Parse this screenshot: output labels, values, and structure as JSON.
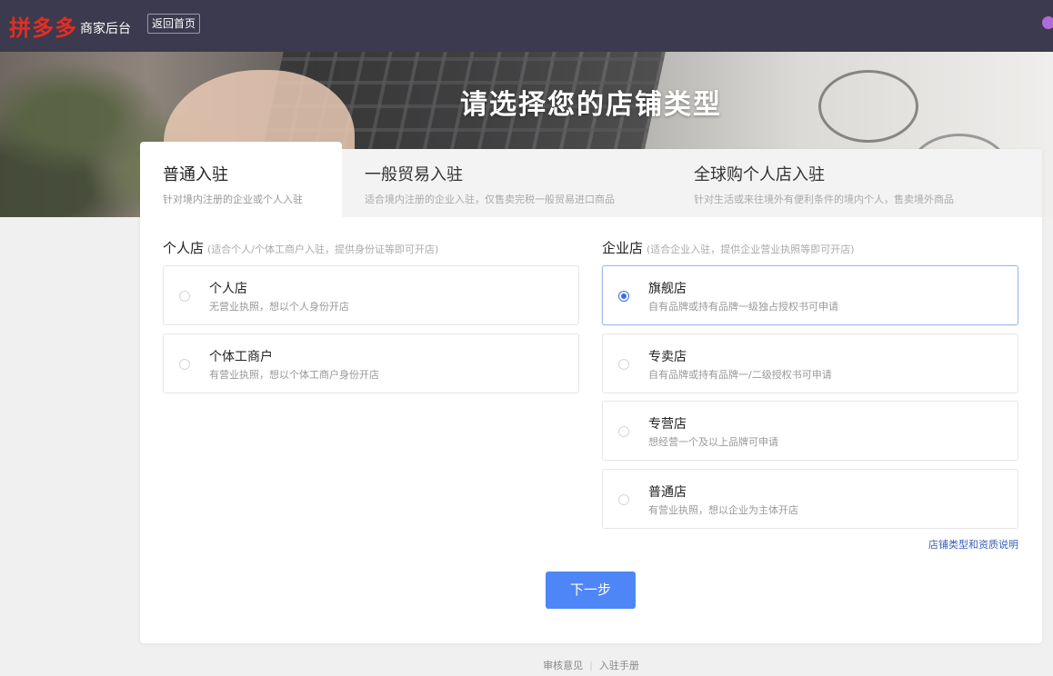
{
  "header": {
    "logo": "拼多多",
    "subtitle": "商家后台",
    "back_button": "返回首页"
  },
  "banner": {
    "title": "请选择您的店铺类型"
  },
  "tabs": [
    {
      "title": "普通入驻",
      "subtitle": "针对境内注册的企业或个人入驻",
      "active": true
    },
    {
      "title": "一般贸易入驻",
      "subtitle": "适合境内注册的企业入驻，仅售卖完税一般贸易进口商品",
      "active": false
    },
    {
      "title": "全球购个人店入驻",
      "subtitle": "针对生活或来往境外有便利条件的境内个人，售卖境外商品",
      "active": false
    }
  ],
  "personal": {
    "heading": "个人店",
    "hint": "(适合个人/个体工商户入驻，提供身份证等即可开店)",
    "options": [
      {
        "title": "个人店",
        "desc": "无营业执照，想以个人身份开店",
        "selected": false
      },
      {
        "title": "个体工商户",
        "desc": "有营业执照，想以个体工商户身份开店",
        "selected": false
      }
    ]
  },
  "enterprise": {
    "heading": "企业店",
    "hint": "(适合企业入驻，提供企业营业执照等即可开店)",
    "options": [
      {
        "title": "旗舰店",
        "desc": "自有品牌或持有品牌一级独占授权书可申请",
        "selected": true
      },
      {
        "title": "专卖店",
        "desc": "自有品牌或持有品牌一/二级授权书可申请",
        "selected": false
      },
      {
        "title": "专营店",
        "desc": "想经营一个及以上品牌可申请",
        "selected": false
      },
      {
        "title": "普通店",
        "desc": "有营业执照，想以企业为主体开店",
        "selected": false
      }
    ]
  },
  "info_link": "店铺类型和资质说明",
  "next_button": "下一步",
  "footer": {
    "links": [
      "审核意见",
      "入驻手册"
    ]
  },
  "colors": {
    "topbar": "#3b3a4e",
    "brand_red": "#e02e24",
    "primary_blue": "#4f86f7",
    "radio_selected": "#3a6fe0"
  }
}
